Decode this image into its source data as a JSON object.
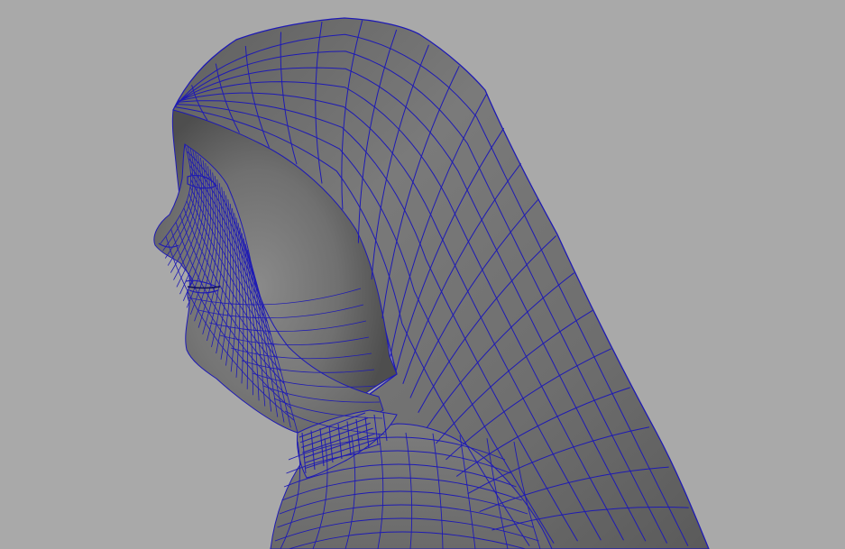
{
  "viewport": {
    "background": "#a9a9a9"
  },
  "model": {
    "subject": "hooded-figure-head-profile",
    "display_mode": "shaded-with-wireframe",
    "shade_color": "#6f6f6f",
    "wire_color": "#1e1ab4"
  }
}
